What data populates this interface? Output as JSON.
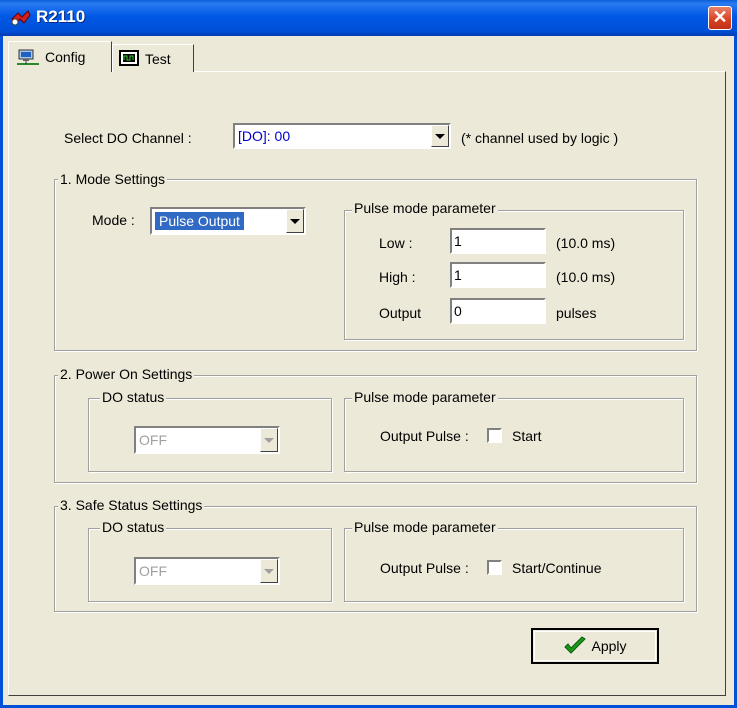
{
  "window": {
    "title": "R2110",
    "close_glyph": "✕"
  },
  "tabs": [
    {
      "label": "Config",
      "icon": "network-computer-icon",
      "selected": true
    },
    {
      "label": "Test",
      "icon": "monitor-chip-icon",
      "selected": false
    }
  ],
  "channel": {
    "label": "Select DO Channel :",
    "value": "[DO]: 00",
    "note": "(* channel used by logic )",
    "value_color": "#0000cc"
  },
  "mode_settings": {
    "group_label": "1. Mode Settings",
    "mode_label": "Mode :",
    "mode_value": "Pulse Output",
    "pulse_group_label": "Pulse mode parameter",
    "low_label": "Low :",
    "low_value": "1",
    "low_unit": "(10.0 ms)",
    "high_label": "High :",
    "high_value": "1",
    "high_unit": "(10.0 ms)",
    "output_label": "Output",
    "output_value": "0",
    "output_unit": "pulses"
  },
  "power_on": {
    "group_label": "2. Power On Settings",
    "do_status_label": "DO status",
    "do_status_value": "OFF",
    "pulse_group_label": "Pulse mode parameter",
    "output_pulse_label": "Output Pulse :",
    "checkbox_label": "Start",
    "checked": false
  },
  "safe_status": {
    "group_label": "3. Safe Status Settings",
    "do_status_label": "DO status",
    "do_status_value": "OFF",
    "pulse_group_label": "Pulse mode parameter",
    "output_pulse_label": "Output Pulse :",
    "checkbox_label": "Start/Continue",
    "checked": false
  },
  "apply": {
    "label": "Apply",
    "icon": "checkmark-icon"
  }
}
